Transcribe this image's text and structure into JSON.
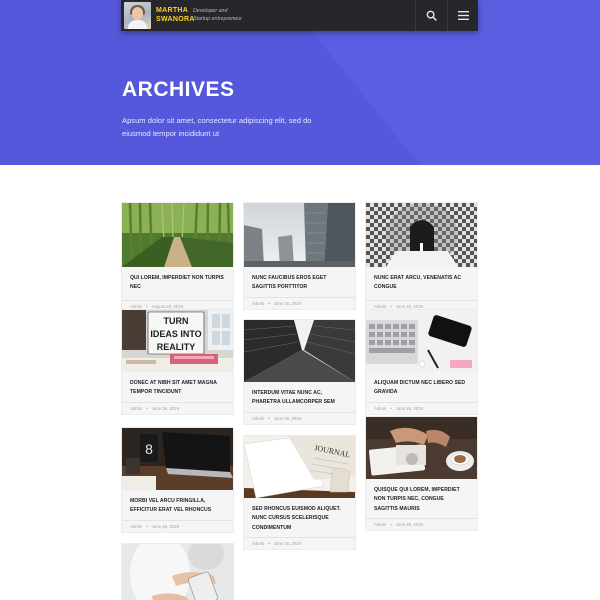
{
  "header": {
    "brand_line1": "MARTHA",
    "brand_line2": "SWANORA",
    "tagline_line1": "Developer and",
    "tagline_line2": "Startup entrepreneur",
    "search_icon": "search-icon",
    "menu_icon": "hamburger-menu-icon"
  },
  "hero": {
    "title": "ARCHIVES",
    "description": "Apsum dolor sit amet, consectetur adipiscing elit, sed do eiusmod tempor incididunt ut"
  },
  "colors": {
    "hero_bg": "#5b5ee0",
    "header_bg": "#26262b",
    "brand_yellow": "#ffd21f"
  },
  "posts": [
    {
      "title": "QUI LOREM, IMPERDIET NON TURPIS NEC",
      "author": "Admin",
      "date": "August 26, 2019"
    },
    {
      "title": "DONEC AT NIBH SIT AMET MAGNA TEMPOR TINCIDUNT",
      "author": "Admin",
      "date": "June 26, 2019"
    },
    {
      "title": "MORBI VEL ARCU FRINGILLA, EFFICITUR ERAT VEL RHONCUS",
      "author": "Admin",
      "date": "June 26, 2019"
    },
    {
      "title": "NUNC FAUCIBUS EROS EGET SAGITTIS PORTTITOR",
      "author": "Admin",
      "date": "June 26, 2019"
    },
    {
      "title": "INTERDUM VITAE NUNC AC, PHARETRA ULLAMCORPER SEM",
      "author": "Admin",
      "date": "June 26, 2019"
    },
    {
      "title": "SED RHONCUS EUISMOD ALIQUET. NUNC CURSUS SCELERISQUE CONDIMENTUM",
      "author": "Admin",
      "date": "June 26, 2019"
    },
    {
      "title": "NUNC ERAT ARCU, VENENATIS AC CONGUE",
      "author": "Admin",
      "date": "June 26, 2019"
    },
    {
      "title": "ALIQUAM DICTUM NEC LIBERO SED GRAVIDA",
      "author": "Admin",
      "date": "June 26, 2019"
    },
    {
      "title": "QUISQUE QUI LOREM, IMPERDIET NON TURPIS NEC, CONGUE SAGITTIS MAURIS",
      "author": "Admin",
      "date": "June 26, 2019"
    }
  ],
  "thumbs": {
    "p2": {
      "line1": "TURN",
      "line2": "IDEAS INTO",
      "line3": "REALITY"
    },
    "p6": {
      "label": "JOURNAL"
    }
  }
}
